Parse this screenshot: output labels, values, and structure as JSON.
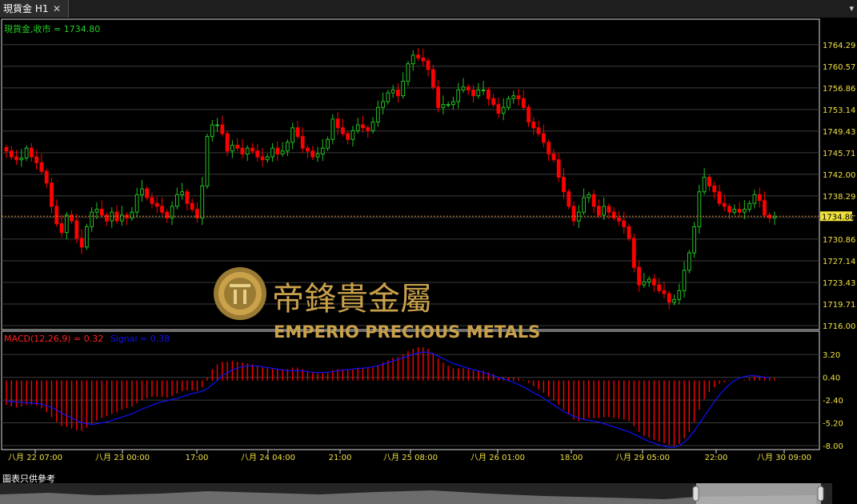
{
  "tab": {
    "title": "現貨金 H1",
    "close": "✕",
    "menu": "▾"
  },
  "price_panel": {
    "label": "現貨金,收市 = 1734.80",
    "current_price": 1734.8,
    "current_price_label": "1734.80",
    "y_ticks": [
      "1764.29",
      "1760.57",
      "1756.86",
      "1753.14",
      "1749.43",
      "1745.71",
      "1742.00",
      "1738.29",
      "1734.57",
      "1730.86",
      "1727.14",
      "1723.43",
      "1719.71",
      "1716.00"
    ]
  },
  "macd_panel": {
    "label_macd": "MACD(12,26,9) = 0.32",
    "label_signal": "Signal = 0.38",
    "y_ticks": [
      "3.20",
      "0.40",
      "-2.40",
      "-5.20",
      "-8.00"
    ]
  },
  "x_ticks": [
    "八月 22 07:00",
    "八月 23 00:00",
    "17:00",
    "八月 24 04:00",
    "21:00",
    "八月 25 08:00",
    "八月 26 01:00",
    "18:00",
    "八月 29 05:00",
    "22:00",
    "八月 30 09:00"
  ],
  "logo": {
    "cn": "帝鋒貴金屬",
    "en": "EMPERIO PRECIOUS METALS"
  },
  "footer_note": "圖表只供參考",
  "colors": {
    "up": "#22c222",
    "down": "#ff0000",
    "grid": "#3c3c3c",
    "text": "#f0e040",
    "macd_label": "#ff0000",
    "signal": "#0000ff",
    "price_label": "#22d022"
  },
  "chart_data": [
    {
      "type": "candlestick",
      "title": "",
      "ylim": [
        1716.0,
        1765.5
      ],
      "close": [
        1746.0,
        1745.0,
        1744.5,
        1744.8,
        1746.5,
        1745.0,
        1744.0,
        1742.5,
        1740.5,
        1736.5,
        1733.5,
        1732.0,
        1735.0,
        1734.0,
        1731.0,
        1729.5,
        1733.0,
        1735.5,
        1736.0,
        1735.0,
        1734.0,
        1735.5,
        1734.0,
        1735.0,
        1734.5,
        1735.5,
        1738.5,
        1739.5,
        1738.0,
        1737.0,
        1736.5,
        1735.5,
        1734.5,
        1736.5,
        1738.5,
        1739.0,
        1737.0,
        1736.0,
        1734.5,
        1740.0,
        1748.5,
        1750.5,
        1750.5,
        1749.0,
        1746.0,
        1747.0,
        1746.5,
        1745.5,
        1746.5,
        1746.0,
        1745.0,
        1744.5,
        1745.0,
        1746.5,
        1745.5,
        1746.0,
        1747.5,
        1750.0,
        1748.5,
        1746.5,
        1746.0,
        1745.0,
        1745.5,
        1746.5,
        1748.0,
        1751.5,
        1750.0,
        1749.0,
        1748.0,
        1749.5,
        1750.5,
        1750.0,
        1749.5,
        1751.0,
        1753.5,
        1754.5,
        1756.0,
        1756.5,
        1755.5,
        1758.0,
        1761.0,
        1762.5,
        1762.0,
        1761.5,
        1760.0,
        1757.0,
        1753.5,
        1754.0,
        1754.0,
        1754.5,
        1756.5,
        1757.0,
        1756.5,
        1755.5,
        1756.5,
        1756.5,
        1755.0,
        1754.0,
        1752.5,
        1753.5,
        1755.0,
        1755.5,
        1755.0,
        1753.5,
        1751.0,
        1750.0,
        1749.0,
        1747.5,
        1745.5,
        1744.5,
        1741.5,
        1739.0,
        1736.5,
        1734.0,
        1735.5,
        1738.0,
        1738.5,
        1736.5,
        1735.0,
        1736.5,
        1735.5,
        1734.5,
        1734.0,
        1733.0,
        1731.0,
        1726.0,
        1723.0,
        1723.5,
        1724.0,
        1723.0,
        1722.0,
        1721.5,
        1720.0,
        1720.5,
        1722.0,
        1725.5,
        1728.5,
        1733.0,
        1739.0,
        1741.5,
        1740.0,
        1739.0,
        1737.0,
        1736.5,
        1735.5,
        1736.0,
        1735.5,
        1736.0,
        1737.0,
        1738.5,
        1737.5,
        1735.0,
        1734.5,
        1734.8
      ]
    },
    {
      "type": "bar",
      "title": "",
      "ylim": [
        -8.0,
        4.0
      ],
      "macd": [
        -3.0,
        -3.2,
        -3.3,
        -3.2,
        -3.0,
        -3.0,
        -3.1,
        -3.4,
        -3.9,
        -4.5,
        -5.1,
        -5.6,
        -5.7,
        -5.9,
        -6.1,
        -6.2,
        -5.8,
        -5.3,
        -4.9,
        -4.6,
        -4.4,
        -4.1,
        -3.9,
        -3.6,
        -3.4,
        -3.2,
        -2.8,
        -2.4,
        -2.2,
        -2.0,
        -2.0,
        -2.0,
        -2.1,
        -1.9,
        -1.6,
        -1.3,
        -1.2,
        -1.2,
        -1.3,
        -0.8,
        0.4,
        1.4,
        2.0,
        2.3,
        2.3,
        2.4,
        2.3,
        2.2,
        2.1,
        2.0,
        1.8,
        1.6,
        1.5,
        1.5,
        1.4,
        1.4,
        1.4,
        1.6,
        1.6,
        1.4,
        1.2,
        1.0,
        0.9,
        0.9,
        1.0,
        1.3,
        1.4,
        1.4,
        1.3,
        1.4,
        1.5,
        1.5,
        1.5,
        1.6,
        1.9,
        2.2,
        2.5,
        2.8,
        2.9,
        3.2,
        3.6,
        3.9,
        4.1,
        4.1,
        3.9,
        3.4,
        2.7,
        2.2,
        1.8,
        1.5,
        1.5,
        1.5,
        1.4,
        1.2,
        1.2,
        1.2,
        1.0,
        0.8,
        0.5,
        0.4,
        0.4,
        0.4,
        0.3,
        0.1,
        -0.3,
        -0.7,
        -1.1,
        -1.5,
        -2.0,
        -2.4,
        -3.0,
        -3.6,
        -4.2,
        -4.8,
        -5.0,
        -4.8,
        -4.6,
        -4.6,
        -4.6,
        -4.5,
        -4.5,
        -4.6,
        -4.7,
        -4.8,
        -5.0,
        -5.6,
        -6.3,
        -6.8,
        -7.0,
        -7.3,
        -7.5,
        -7.7,
        -7.9,
        -8.0,
        -7.8,
        -7.1,
        -6.3,
        -5.1,
        -3.6,
        -2.3,
        -1.4,
        -0.8,
        -0.4,
        -0.2,
        -0.1,
        0.0,
        0.0,
        0.1,
        0.3,
        0.5,
        0.6,
        0.5,
        0.4,
        0.3
      ],
      "signal": [
        -2.5,
        -2.6,
        -2.6,
        -2.7,
        -2.7,
        -2.8,
        -2.8,
        -2.9,
        -3.1,
        -3.3,
        -3.6,
        -4.0,
        -4.3,
        -4.6,
        -4.9,
        -5.2,
        -5.3,
        -5.4,
        -5.3,
        -5.2,
        -5.1,
        -4.9,
        -4.7,
        -4.5,
        -4.3,
        -4.1,
        -3.8,
        -3.5,
        -3.3,
        -3.0,
        -2.8,
        -2.6,
        -2.5,
        -2.3,
        -2.2,
        -2.0,
        -1.8,
        -1.6,
        -1.5,
        -1.3,
        -1.0,
        -0.5,
        0.0,
        0.6,
        1.0,
        1.3,
        1.5,
        1.7,
        1.8,
        1.8,
        1.8,
        1.7,
        1.6,
        1.5,
        1.4,
        1.3,
        1.2,
        1.2,
        1.2,
        1.2,
        1.1,
        1.0,
        1.0,
        1.0,
        1.0,
        1.1,
        1.2,
        1.3,
        1.3,
        1.4,
        1.5,
        1.5,
        1.6,
        1.7,
        1.8,
        2.0,
        2.2,
        2.4,
        2.6,
        2.8,
        3.0,
        3.2,
        3.4,
        3.5,
        3.5,
        3.3,
        3.0,
        2.7,
        2.4,
        2.1,
        1.9,
        1.7,
        1.5,
        1.3,
        1.2,
        1.0,
        0.8,
        0.6,
        0.4,
        0.2,
        0.0,
        -0.2,
        -0.5,
        -0.8,
        -1.1,
        -1.5,
        -1.8,
        -2.2,
        -2.6,
        -3.0,
        -3.4,
        -3.8,
        -4.1,
        -4.4,
        -4.6,
        -4.8,
        -4.9,
        -5.0,
        -5.1,
        -5.3,
        -5.5,
        -5.7,
        -5.9,
        -6.1,
        -6.3,
        -6.6,
        -6.9,
        -7.2,
        -7.5,
        -7.7,
        -7.9,
        -8.1,
        -8.2,
        -8.2,
        -8.0,
        -7.6,
        -7.0,
        -6.2,
        -5.3,
        -4.4,
        -3.5,
        -2.6,
        -1.8,
        -1.1,
        -0.5,
        0.0,
        0.3,
        0.5,
        0.6,
        0.6,
        0.5,
        0.4,
        0.38
      ]
    }
  ]
}
